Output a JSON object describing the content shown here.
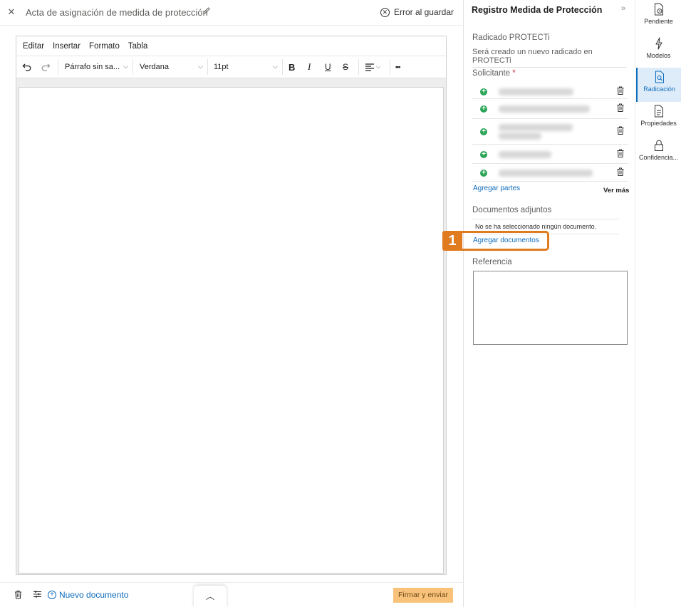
{
  "document": {
    "title": "Acta de asignación de medida de protección",
    "save_status": "Error al guardar"
  },
  "editor": {
    "menu": [
      "Editar",
      "Insertar",
      "Formato",
      "Tabla"
    ],
    "toolbar": {
      "paragraph_style": "Párrafo sin sa...",
      "font_family": "Verdana",
      "font_size": "11pt",
      "bold": "B",
      "italic": "I",
      "underline": "U",
      "strikethrough": "S",
      "more": "•••"
    }
  },
  "footer": {
    "new_document": "Nuevo documento",
    "sign_send": "Firmar y enviar"
  },
  "panel": {
    "title": "Registro Medida de Protección",
    "radicado_label": "Radicado PROTECTi",
    "radicado_value": "Será creado un nuevo radicado en PROTECTi",
    "solicitante_label": "Solicitante",
    "required_mark": "*",
    "add_parties": "Agregar partes",
    "see_more": "Ver más",
    "attachments_label": "Documentos adjuntos",
    "no_document": "No se ha seleccionado ningún documento.",
    "add_documents": "Agregar documentos",
    "reference_label": "Referencia",
    "callout_number": "1"
  },
  "rail": [
    {
      "label": "Pendiente",
      "icon": "pending-doc-icon"
    },
    {
      "label": "Modelos",
      "icon": "lightning-icon"
    },
    {
      "label": "Radicación",
      "icon": "doc-search-icon",
      "active": true
    },
    {
      "label": "Propiedades",
      "icon": "doc-properties-icon"
    },
    {
      "label": "Confidencia...",
      "icon": "lock-icon"
    }
  ],
  "colors": {
    "accent": "#0f6cbd",
    "callout": "#e07b1f",
    "sign_button": "#f9c27a",
    "add_party": "#2aa556"
  }
}
